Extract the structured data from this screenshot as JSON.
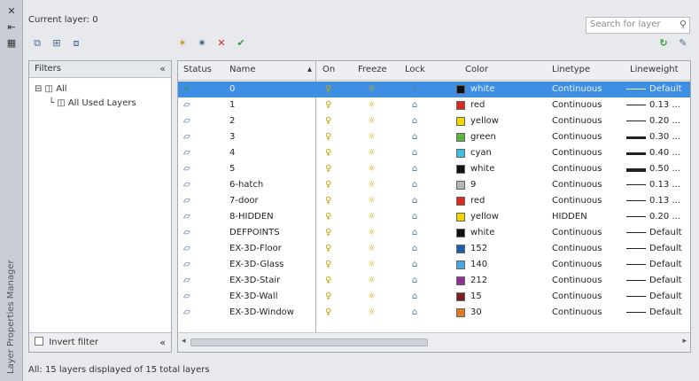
{
  "panel_title": "Layer Properties Manager",
  "current_layer": "Current layer: 0",
  "search": {
    "placeholder": "Search for layer"
  },
  "filters": {
    "header": "Filters",
    "all": "All",
    "all_used": "All Used Layers",
    "invert_label": "Invert filter"
  },
  "columns": {
    "status": "Status",
    "name": "Name",
    "on": "On",
    "freeze": "Freeze",
    "lock": "Lock",
    "color": "Color",
    "linetype": "Linetype",
    "lineweight": "Lineweight"
  },
  "colors": {
    "selected_row": "#3e8ee3",
    "accent_red": "#d02a2a",
    "accent_green": "#2ea02e"
  },
  "layers": [
    {
      "name": "0",
      "color_name": "white",
      "color_hex": "#111111",
      "linetype": "Continuous",
      "lineweight": "Default",
      "lw_thickness": 1,
      "selected": true
    },
    {
      "name": "1",
      "color_name": "red",
      "color_hex": "#d42a1f",
      "linetype": "Continuous",
      "lineweight": "0.13 ...",
      "lw_thickness": 1
    },
    {
      "name": "2",
      "color_name": "yellow",
      "color_hex": "#f2d600",
      "linetype": "Continuous",
      "lineweight": "0.20 ...",
      "lw_thickness": 1
    },
    {
      "name": "3",
      "color_name": "green",
      "color_hex": "#5fb043",
      "linetype": "Continuous",
      "lineweight": "0.30 ...",
      "lw_thickness": 3
    },
    {
      "name": "4",
      "color_name": "cyan",
      "color_hex": "#3bc0e0",
      "linetype": "Continuous",
      "lineweight": "0.40 ...",
      "lw_thickness": 3
    },
    {
      "name": "5",
      "color_name": "white",
      "color_hex": "#111111",
      "linetype": "Continuous",
      "lineweight": "0.50 ...",
      "lw_thickness": 4
    },
    {
      "name": "6-hatch",
      "color_name": "9",
      "color_hex": "#b5b5b5",
      "linetype": "Continuous",
      "lineweight": "0.13 ...",
      "lw_thickness": 1
    },
    {
      "name": "7-door",
      "color_name": "red",
      "color_hex": "#d42a1f",
      "linetype": "Continuous",
      "lineweight": "0.13 ...",
      "lw_thickness": 1
    },
    {
      "name": "8-HIDDEN",
      "color_name": "yellow",
      "color_hex": "#f2d600",
      "linetype": "HIDDEN",
      "lineweight": "0.20 ...",
      "lw_thickness": 1
    },
    {
      "name": "DEFPOINTS",
      "color_name": "white",
      "color_hex": "#111111",
      "linetype": "Continuous",
      "lineweight": "Default",
      "lw_thickness": 1
    },
    {
      "name": "EX-3D-Floor",
      "color_name": "152",
      "color_hex": "#1b5fa8",
      "linetype": "Continuous",
      "lineweight": "Default",
      "lw_thickness": 1
    },
    {
      "name": "EX-3D-Glass",
      "color_name": "140",
      "color_hex": "#4aa7d9",
      "linetype": "Continuous",
      "lineweight": "Default",
      "lw_thickness": 1
    },
    {
      "name": "EX-3D-Stair",
      "color_name": "212",
      "color_hex": "#8d3098",
      "linetype": "Continuous",
      "lineweight": "Default",
      "lw_thickness": 1
    },
    {
      "name": "EX-3D-Wall",
      "color_name": "15",
      "color_hex": "#7a1f22",
      "linetype": "Continuous",
      "lineweight": "Default",
      "lw_thickness": 1
    },
    {
      "name": "EX-3D-Window",
      "color_name": "30",
      "color_hex": "#e07a1f",
      "linetype": "Continuous",
      "lineweight": "Default",
      "lw_thickness": 1
    }
  ],
  "status_bar": "All: 15 layers displayed of 15 total layers"
}
